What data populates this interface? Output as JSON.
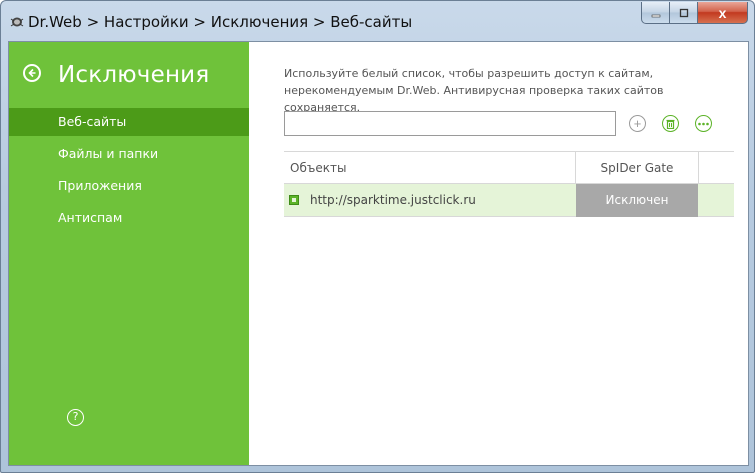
{
  "window": {
    "title": "Dr.Web > Настройки > Исключения > Веб-сайты",
    "close_glyph": "x"
  },
  "sidebar": {
    "title": "Исключения",
    "items": [
      {
        "label": "Веб-сайты",
        "active": true
      },
      {
        "label": "Файлы и папки",
        "active": false
      },
      {
        "label": "Приложения",
        "active": false
      },
      {
        "label": "Антиспам",
        "active": false
      }
    ],
    "help_glyph": "?"
  },
  "main": {
    "description": "Используйте белый список, чтобы разрешить доступ к сайтам, нерекомендуемым Dr.Web. Антивирусная проверка таких сайтов сохраняется.",
    "search": {
      "value": "",
      "placeholder": ""
    },
    "add_glyph": "+",
    "table": {
      "columns": [
        "Объекты",
        "SpIDer Gate"
      ],
      "rows": [
        {
          "url": "http://sparktime.justclick.ru",
          "status": "Исключен",
          "checked": true
        }
      ]
    }
  },
  "colors": {
    "sidebar_bg": "#6fc23a",
    "sidebar_active": "#4c9b18",
    "row_highlight": "#e5f4d8",
    "status_bg": "#a8a8a8",
    "accent": "#5cb328"
  },
  "icons": {
    "app": "drweb-spider-icon",
    "back": "back-arrow-icon",
    "add": "plus-circle-icon",
    "delete": "trash-icon",
    "more": "ellipsis-icon",
    "help": "question-icon"
  }
}
